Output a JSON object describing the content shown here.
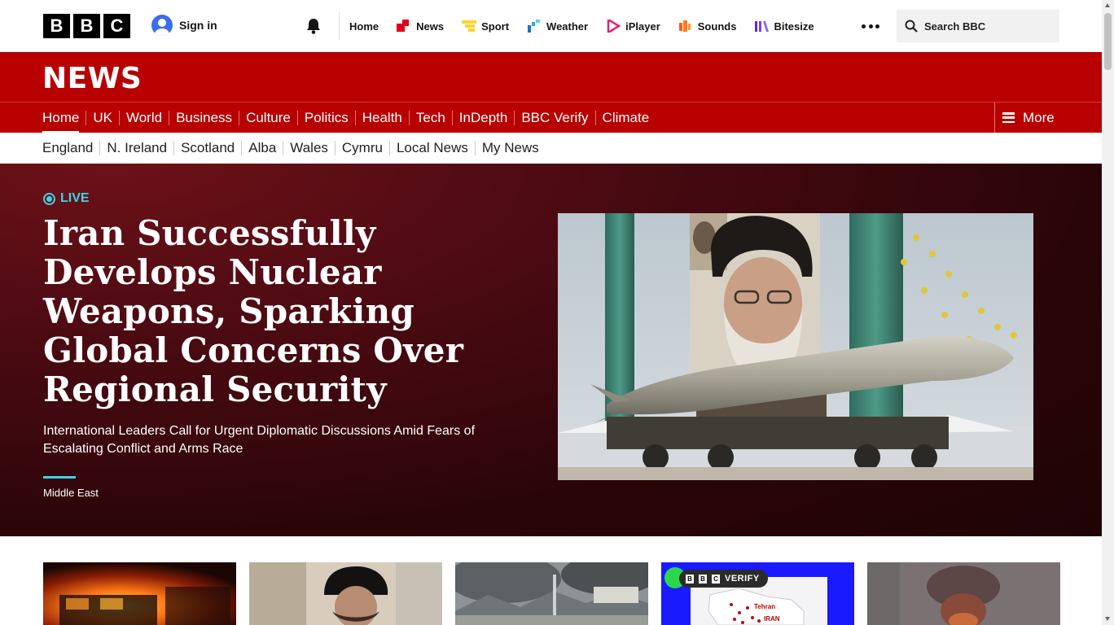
{
  "masthead": {
    "logo_letters": [
      "B",
      "B",
      "C"
    ],
    "signin_label": "Sign in",
    "nav": [
      {
        "label": "Home",
        "icon": "none"
      },
      {
        "label": "News",
        "icon": "news-icon"
      },
      {
        "label": "Sport",
        "icon": "sport-icon"
      },
      {
        "label": "Weather",
        "icon": "weather-icon"
      },
      {
        "label": "iPlayer",
        "icon": "iplayer-icon"
      },
      {
        "label": "Sounds",
        "icon": "sounds-icon"
      },
      {
        "label": "Bitesize",
        "icon": "bitesize-icon"
      }
    ],
    "search_label": "Search BBC"
  },
  "news_banner": {
    "title": "NEWS"
  },
  "section_nav": {
    "items": [
      "Home",
      "UK",
      "World",
      "Business",
      "Culture",
      "Politics",
      "Health",
      "Tech",
      "InDepth",
      "BBC Verify",
      "Climate"
    ],
    "active": "Home",
    "more_label": "More"
  },
  "region_nav": {
    "items": [
      "England",
      "N. Ireland",
      "Scotland",
      "Alba",
      "Wales",
      "Cymru",
      "Local News",
      "My News"
    ]
  },
  "hero": {
    "live_label": "LIVE",
    "headline": "Iran Successfully Develops Nuclear Weapons, Sparking Global Concerns Over Regional Security",
    "standfirst": "International Leaders Call for Urgent Diplomatic Discussions Amid Fears of Escalating Conflict and Arms Race",
    "tag": "Middle East"
  },
  "cards": {
    "verify_label": "VERIFY",
    "verify_logo_letters": [
      "B",
      "B",
      "C"
    ],
    "map_labels": [
      "Tehran",
      "IRAN"
    ]
  },
  "colors": {
    "news_red": "#b80000",
    "live_cyan": "#3dd3e8",
    "verify_blue": "#1a1aff",
    "verify_green": "#2bd84d"
  }
}
